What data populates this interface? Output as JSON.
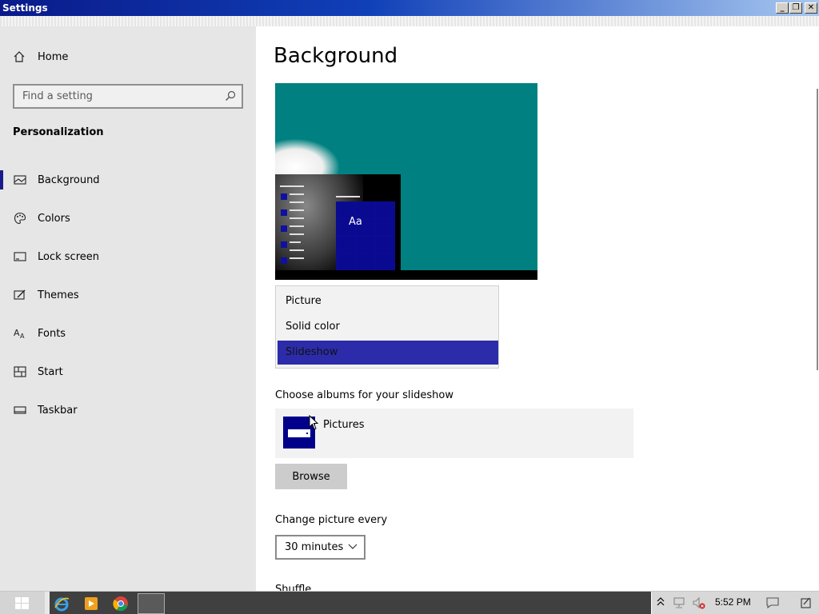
{
  "window": {
    "title": "Settings",
    "minimize": "_",
    "restore": "❐",
    "close": "✕"
  },
  "sidebar": {
    "home": "Home",
    "search_placeholder": "Find a setting",
    "section": "Personalization",
    "items": [
      {
        "label": "Background",
        "icon": "picture-icon",
        "active": true
      },
      {
        "label": "Colors",
        "icon": "palette-icon"
      },
      {
        "label": "Lock screen",
        "icon": "lock-screen-icon"
      },
      {
        "label": "Themes",
        "icon": "themes-icon"
      },
      {
        "label": "Fonts",
        "icon": "fonts-icon",
        "glyph": "A"
      },
      {
        "label": "Start",
        "icon": "start-icon"
      },
      {
        "label": "Taskbar",
        "icon": "taskbar-icon"
      }
    ]
  },
  "main": {
    "title": "Background",
    "preview": {
      "tile_text": "Aa",
      "bg_color": "#008080",
      "tile_color": "#0b0b9a"
    },
    "background_dropdown": {
      "options": [
        "Picture",
        "Solid color",
        "Slideshow"
      ],
      "selected": "Slideshow"
    },
    "albums_label": "Choose albums for your slideshow",
    "album": {
      "name": "Pictures"
    },
    "browse_label": "Browse",
    "change_label": "Change picture every",
    "interval": "30 minutes",
    "shuffle_label": "Shuffle"
  },
  "taskbar": {
    "apps": [
      "internet-explorer-icon",
      "media-player-icon",
      "chrome-icon"
    ],
    "time": "5:52 PM"
  },
  "colors": {
    "accent": "#1a1a8c",
    "selection": "#2c2caa",
    "sidebar_bg": "#e6e6e6"
  }
}
